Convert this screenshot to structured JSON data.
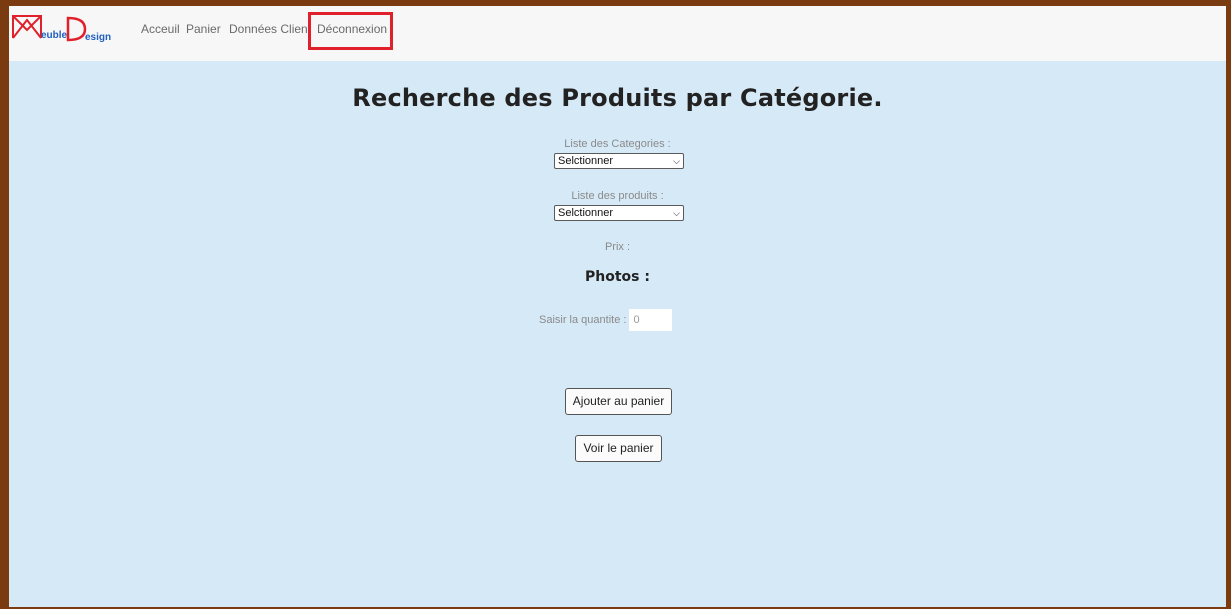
{
  "navbar": {
    "logo_text_1": "euble",
    "logo_text_2": "esign",
    "links": [
      "Acceuil",
      "Panier",
      "Données Client",
      "Déconnexion"
    ]
  },
  "main": {
    "title": "Recherche des Produits par Catégorie.",
    "categories_label": "Liste des Categories :",
    "categories_selected": "Selctionner",
    "products_label": "Liste des produits :",
    "products_selected": "Selctionner",
    "price_label": "Prix :",
    "photos_label": "Photos :",
    "quantity_label": "Saisir la quantite :",
    "quantity_value": "0",
    "add_to_cart": "Ajouter au panier",
    "view_cart": "Voir le panier"
  },
  "colors": {
    "border": "#7a3b10",
    "background": "#d6e9f7",
    "navbar": "#f7f7f8",
    "highlight": "#e0212b",
    "logo_red": "#e0212b",
    "logo_blue": "#1f5fbf"
  },
  "icons": {
    "select_arrow": "chevron-down-icon"
  }
}
